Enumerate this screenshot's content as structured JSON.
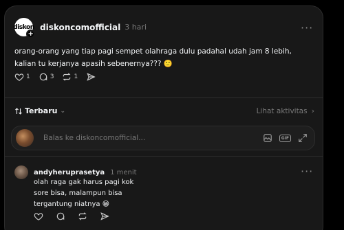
{
  "post": {
    "avatar_text": "diskon",
    "username": "diskoncomofficial",
    "time": "3 hari",
    "text": "orang-orang yang tiap pagi sempet olahraga dulu padahal udah jam 8 lebih, kalian tu kerjanya apasih sebenernya??? 🙂",
    "likes": "1",
    "comments": "3",
    "reposts": "1"
  },
  "sort": {
    "label": "Terbaru",
    "activity_link": "Lihat aktivitas"
  },
  "reply": {
    "placeholder": "Balas ke diskoncomofficial..."
  },
  "comment": {
    "username": "andyheruprasetya",
    "time": "1 menit",
    "lines": [
      "olah raga gak harus pagi kok",
      "sore bisa, malampun bisa",
      "tergantung niatnya 😁"
    ]
  },
  "icons": {
    "like": "heart-icon",
    "comment": "speech-bubble-icon",
    "repost": "repost-icon",
    "share": "send-icon",
    "sort": "sort-arrows-icon",
    "image": "image-icon",
    "gif": "gif-icon",
    "expand": "expand-icon",
    "more": "more-icon"
  },
  "colors": {
    "background": "#000000",
    "card": "#181818",
    "text_primary": "#f3f5f7",
    "text_secondary": "#777777",
    "border": "#2d2d2d"
  }
}
